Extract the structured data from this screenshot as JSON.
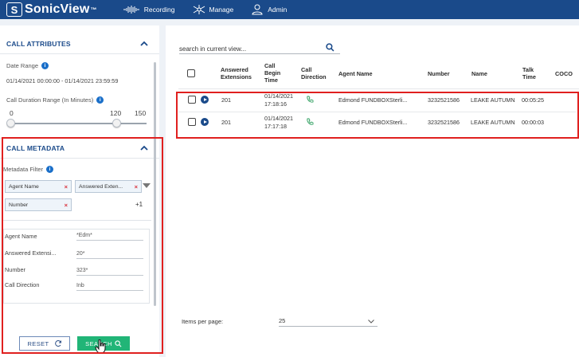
{
  "app": {
    "title": "SonicView",
    "trademark": "™"
  },
  "nav": [
    {
      "label": "Recording",
      "icon": "waveform-icon"
    },
    {
      "label": "Manage",
      "icon": "network-icon"
    },
    {
      "label": "Admin",
      "icon": "users-icon"
    }
  ],
  "call_attributes": {
    "heading": "CALL ATTRIBUTES",
    "date_range_label": "Date Range",
    "date_range_value": "01/14/2021 00:00:00 - 01/14/2021 23:59:59",
    "duration_label": "Call Duration Range (In Minutes)",
    "duration_min": "0",
    "duration_low_value": "120",
    "duration_max": "150"
  },
  "call_metadata": {
    "heading": "CALL METADATA",
    "filter_label": "Metadata Filter",
    "chips": [
      "Agent Name",
      "Answered Exten...",
      "Number"
    ],
    "more_count": "+1",
    "filters": [
      {
        "label": "Agent Name",
        "value": "*Edm*"
      },
      {
        "label": "Answered Extensi...",
        "value": "20*"
      },
      {
        "label": "Number",
        "value": "323*"
      },
      {
        "label": "Call Direction",
        "value": "Inb"
      }
    ]
  },
  "buttons": {
    "reset": "RESET",
    "search": "SEARCH"
  },
  "search": {
    "placeholder": "search in current view..."
  },
  "table": {
    "headers": {
      "ext": [
        "Answered",
        "Extensions"
      ],
      "time": [
        "Call",
        "Begin",
        "Time"
      ],
      "dir": [
        "Call",
        "Direction"
      ],
      "agent": "Agent Name",
      "number": "Number",
      "name": "Name",
      "talk": [
        "Talk",
        "Time"
      ],
      "coco": "COCO"
    },
    "rows": [
      {
        "ext": "201",
        "date": "01/14/2021",
        "time": "17:18:16",
        "agent": "Edmond FUNDBOXSterli...",
        "number": "3232521586",
        "name": "LEAKE AUTUMN",
        "talk": "00:05:25"
      },
      {
        "ext": "201",
        "date": "01/14/2021",
        "time": "17:17:18",
        "agent": "Edmond FUNDBOXSterli...",
        "number": "3232521586",
        "name": "LEAKE AUTUMN",
        "talk": "00:00:03"
      }
    ]
  },
  "pager": {
    "label": "Items per page:",
    "value": "25"
  },
  "colors": {
    "primary": "#1a4a8a",
    "accent_green": "#21b577",
    "highlight_red": "#e0201f",
    "phone_green": "#2a9d5c"
  }
}
